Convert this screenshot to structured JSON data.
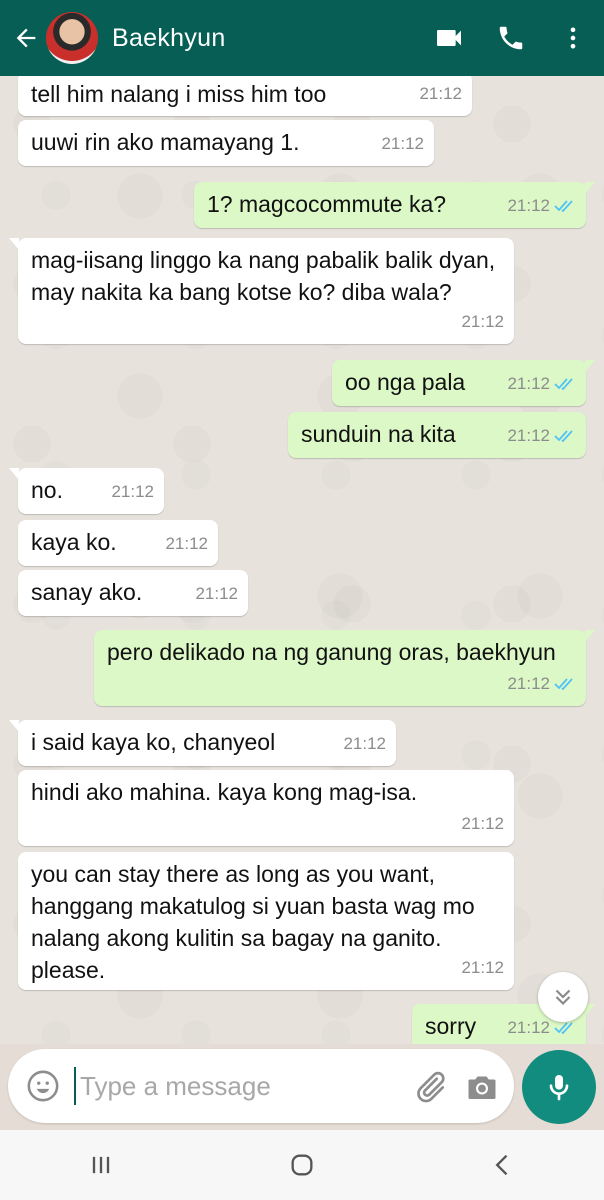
{
  "header": {
    "contact_name": "Baekhyun",
    "background": "#075e54"
  },
  "messages": [
    {
      "dir": "in",
      "text": "tell him nalang i miss him too",
      "time": "21:12"
    },
    {
      "dir": "in",
      "text": "uuwi rin ako mamayang 1.",
      "time": "21:12"
    },
    {
      "dir": "out",
      "text": "1? magcocommute ka?",
      "time": "21:12",
      "status": "read"
    },
    {
      "dir": "in",
      "text": "mag-iisang linggo ka nang pabalik balik dyan, may nakita ka bang kotse ko? diba wala?",
      "time": "21:12"
    },
    {
      "dir": "out",
      "text": "oo nga pala",
      "time": "21:12",
      "status": "read"
    },
    {
      "dir": "out",
      "text": "sunduin na kita",
      "time": "21:12",
      "status": "read"
    },
    {
      "dir": "in",
      "text": "no.",
      "time": "21:12"
    },
    {
      "dir": "in",
      "text": "kaya ko.",
      "time": "21:12"
    },
    {
      "dir": "in",
      "text": "sanay ako.",
      "time": "21:12"
    },
    {
      "dir": "out",
      "text": "pero delikado na ng ganung oras, baekhyun",
      "time": "21:12",
      "status": "read"
    },
    {
      "dir": "in",
      "text": "i said kaya ko, chanyeol",
      "time": "21:12"
    },
    {
      "dir": "in",
      "text": "hindi ako mahina. kaya kong mag-isa.",
      "time": "21:12"
    },
    {
      "dir": "in",
      "text": "you can stay there as long as you want, hanggang makatulog si yuan basta wag mo nalang akong kulitin sa bagay na ganito. please.",
      "time": "21:12"
    },
    {
      "dir": "out",
      "text": "sorry",
      "time": "21:12",
      "status": "read"
    }
  ],
  "composer": {
    "placeholder": "Type a message"
  },
  "colors": {
    "incoming_bubble": "#ffffff",
    "outgoing_bubble": "#dcf8c6",
    "read_ticks": "#4fc3f7",
    "accent": "#128c7e"
  },
  "icons": {
    "back": "arrow-left-icon",
    "video": "video-camera-icon",
    "call": "phone-icon",
    "menu": "more-vertical-icon",
    "emoji": "emoji-icon",
    "attach": "paperclip-icon",
    "camera": "camera-icon",
    "mic": "microphone-icon",
    "scroll": "double-chevron-down-icon"
  }
}
